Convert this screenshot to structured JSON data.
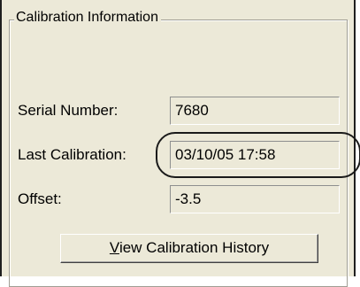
{
  "group": {
    "title": "Calibration Information"
  },
  "fields": {
    "serial": {
      "label": "Serial Number:",
      "value": "7680"
    },
    "last_calibration": {
      "label": "Last Calibration:",
      "value": "03/10/05 17:58"
    },
    "offset": {
      "label": "Offset:",
      "value": "-3.5"
    }
  },
  "button": {
    "mnemonic": "V",
    "label_rest": "iew Calibration History"
  }
}
